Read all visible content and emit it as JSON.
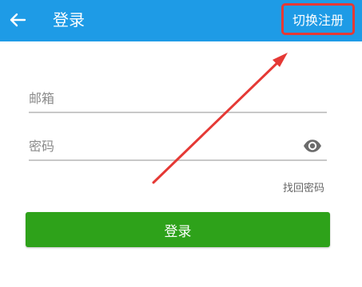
{
  "appbar": {
    "title": "登录",
    "switch_label": "切换注册",
    "color": "#1e9be6"
  },
  "icons": {
    "back": "back-arrow-icon",
    "visibility": "eye-icon"
  },
  "form": {
    "email": {
      "value": "",
      "placeholder": "邮箱"
    },
    "password": {
      "value": "",
      "placeholder": "密码"
    },
    "forgot_label": "找回密码"
  },
  "actions": {
    "login_label": "登录",
    "login_color": "#2ea21a"
  },
  "annotation": {
    "highlight_color": "#e53935"
  }
}
